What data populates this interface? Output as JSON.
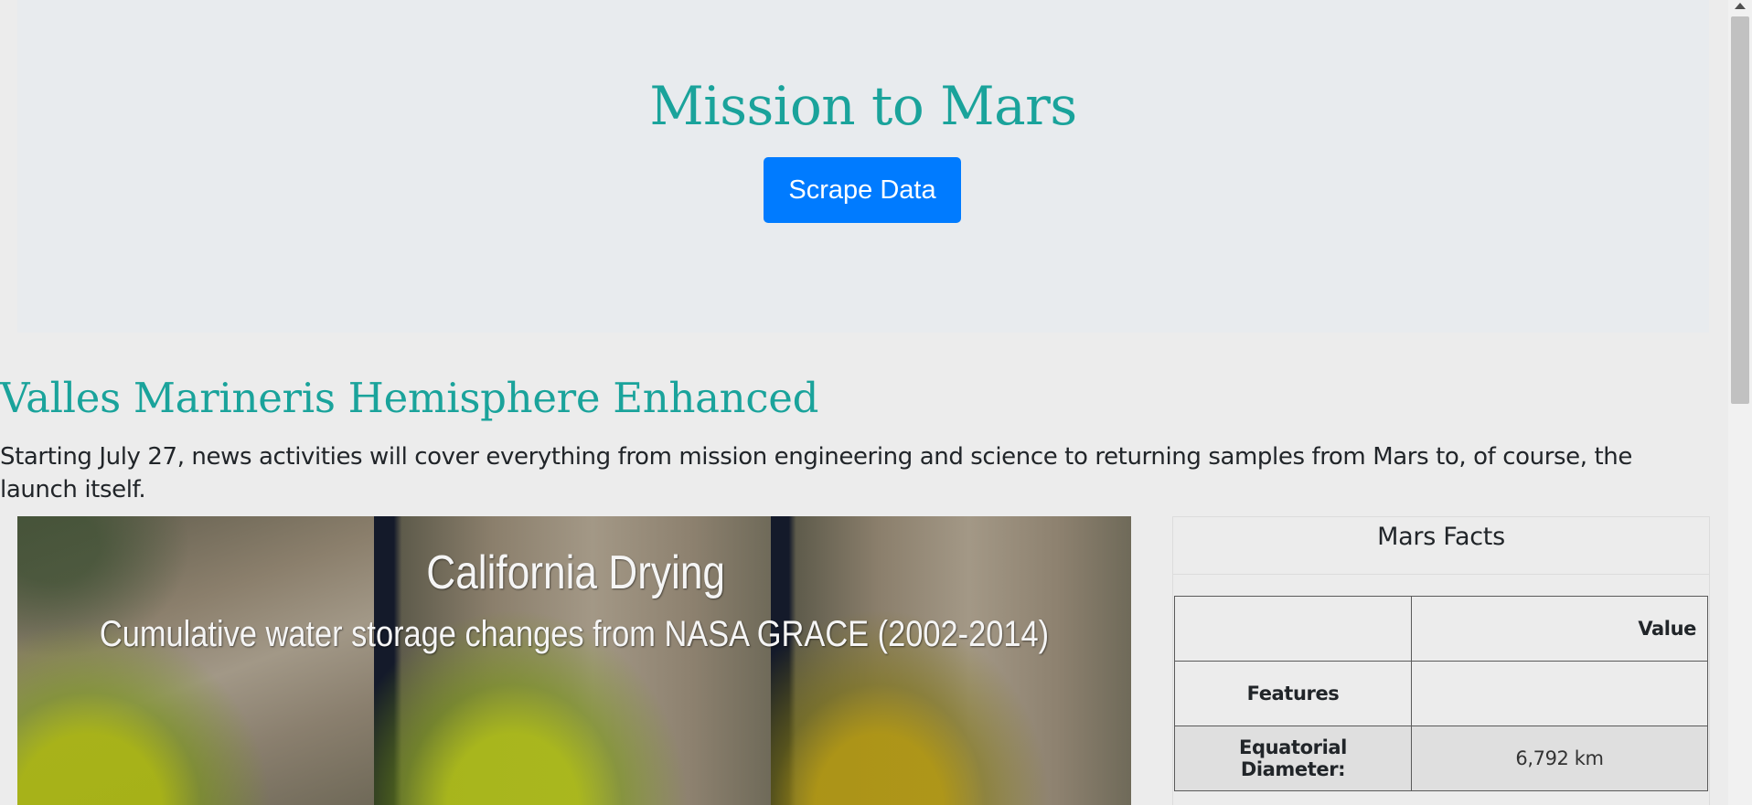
{
  "header": {
    "title": "Mission to Mars",
    "scrape_button": "Scrape Data"
  },
  "news": {
    "title": "Valles Marineris Hemisphere Enhanced",
    "paragraph": "Starting July 27, news activities will cover everything from mission engineering and science to returning samples from Mars to, of course, the launch itself."
  },
  "featured_image": {
    "title": "California Drying",
    "subtitle": "Cumulative water storage changes from NASA GRACE (2002-2014)"
  },
  "mars_facts": {
    "title": "Mars Facts",
    "header": [
      "",
      "Value"
    ],
    "rows": [
      {
        "label": "Features",
        "value": ""
      },
      {
        "label": "Equatorial Diameter:",
        "value": "6,792 km"
      }
    ]
  },
  "colors": {
    "accent": "#1aa39b",
    "button": "#007bff",
    "jumbotron_bg": "#e8ebee",
    "page_bg": "#ececec"
  }
}
